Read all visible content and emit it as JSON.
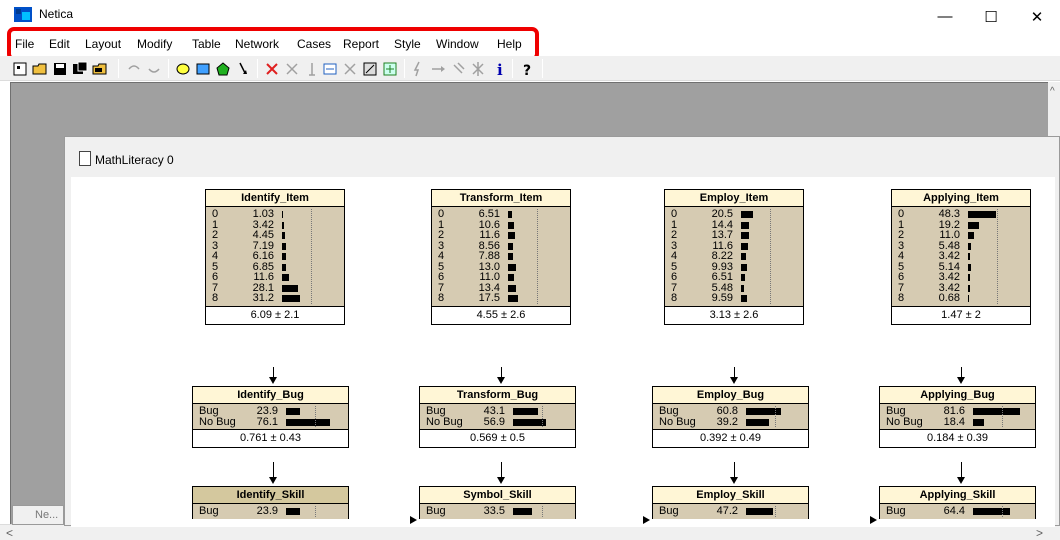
{
  "app": {
    "title": "Netica"
  },
  "window_controls": {
    "minimize": "—",
    "maximize": "☐",
    "close": "✕"
  },
  "menu": [
    "File",
    "Edit",
    "Layout",
    "Modify",
    "Table",
    "Network",
    "Cases",
    "Report",
    "Style",
    "Window",
    "Help"
  ],
  "document": {
    "title": "MathLiteracy 0",
    "minimized_tab": "Ne..."
  },
  "nodes": [
    {
      "id": "identify_item",
      "title": "Identify_Item",
      "kind": "item",
      "states": [
        "0",
        "1",
        "2",
        "3",
        "4",
        "5",
        "6",
        "7",
        "8"
      ],
      "probs": [
        "1.03",
        "3.42",
        "4.45",
        "7.19",
        "6.16",
        "6.85",
        "11.6",
        "28.1",
        "31.2"
      ],
      "values": [
        1.03,
        3.42,
        4.45,
        7.19,
        6.16,
        6.85,
        11.6,
        28.1,
        31.2
      ],
      "summary": "6.09 ± 2.1"
    },
    {
      "id": "transform_item",
      "title": "Transform_Item",
      "kind": "item",
      "states": [
        "0",
        "1",
        "2",
        "3",
        "4",
        "5",
        "6",
        "7",
        "8"
      ],
      "probs": [
        "6.51",
        "10.6",
        "11.6",
        "8.56",
        "7.88",
        "13.0",
        "11.0",
        "13.4",
        "17.5"
      ],
      "values": [
        6.51,
        10.6,
        11.6,
        8.56,
        7.88,
        13.0,
        11.0,
        13.4,
        17.5
      ],
      "summary": "4.55 ± 2.6"
    },
    {
      "id": "employ_item",
      "title": "Employ_Item",
      "kind": "item",
      "states": [
        "0",
        "1",
        "2",
        "3",
        "4",
        "5",
        "6",
        "7",
        "8"
      ],
      "probs": [
        "20.5",
        "14.4",
        "13.7",
        "11.6",
        "8.22",
        "9.93",
        "6.51",
        "5.48",
        "9.59"
      ],
      "values": [
        20.5,
        14.4,
        13.7,
        11.6,
        8.22,
        9.93,
        6.51,
        5.48,
        9.59
      ],
      "summary": "3.13 ± 2.6"
    },
    {
      "id": "applying_item",
      "title": "Applying_Item",
      "kind": "item",
      "states": [
        "0",
        "1",
        "2",
        "3",
        "4",
        "5",
        "6",
        "7",
        "8"
      ],
      "probs": [
        "48.3",
        "19.2",
        "11.0",
        "5.48",
        "3.42",
        "5.14",
        "3.42",
        "3.42",
        "0.68"
      ],
      "values": [
        48.3,
        19.2,
        11.0,
        5.48,
        3.42,
        5.14,
        3.42,
        3.42,
        0.68
      ],
      "summary": "1.47 ± 2"
    },
    {
      "id": "identify_bug",
      "title": "Identify_Bug",
      "kind": "bug",
      "states": [
        "Bug",
        "No Bug"
      ],
      "probs": [
        "23.9",
        "76.1"
      ],
      "values": [
        23.9,
        76.1
      ],
      "summary": "0.761 ± 0.43"
    },
    {
      "id": "transform_bug",
      "title": "Transform_Bug",
      "kind": "bug",
      "states": [
        "Bug",
        "No Bug"
      ],
      "probs": [
        "43.1",
        "56.9"
      ],
      "values": [
        43.1,
        56.9
      ],
      "summary": "0.569 ± 0.5"
    },
    {
      "id": "employ_bug",
      "title": "Employ_Bug",
      "kind": "bug",
      "states": [
        "Bug",
        "No Bug"
      ],
      "probs": [
        "60.8",
        "39.2"
      ],
      "values": [
        60.8,
        39.2
      ],
      "summary": "0.392 ± 0.49"
    },
    {
      "id": "applying_bug",
      "title": "Applying_Bug",
      "kind": "bug",
      "states": [
        "Bug",
        "No Bug"
      ],
      "probs": [
        "81.6",
        "18.4"
      ],
      "values": [
        81.6,
        18.4
      ],
      "summary": "0.184 ± 0.39"
    },
    {
      "id": "identify_skill",
      "title": "Identify_Skill",
      "kind": "skill",
      "states": [
        "Bug"
      ],
      "probs": [
        "23.9"
      ],
      "values": [
        23.9
      ],
      "summary": ""
    },
    {
      "id": "symbol_skill",
      "title": "Symbol_Skill",
      "kind": "skill-plain",
      "states": [
        "Bug"
      ],
      "probs": [
        "33.5"
      ],
      "values": [
        33.5
      ],
      "summary": ""
    },
    {
      "id": "employ_skill",
      "title": "Employ_Skill",
      "kind": "skill-plain",
      "states": [
        "Bug"
      ],
      "probs": [
        "47.2"
      ],
      "values": [
        47.2
      ],
      "summary": ""
    },
    {
      "id": "applying_skill",
      "title": "Applying_Skill",
      "kind": "skill-plain",
      "states": [
        "Bug"
      ],
      "probs": [
        "64.4"
      ],
      "values": [
        64.4
      ],
      "summary": ""
    }
  ]
}
